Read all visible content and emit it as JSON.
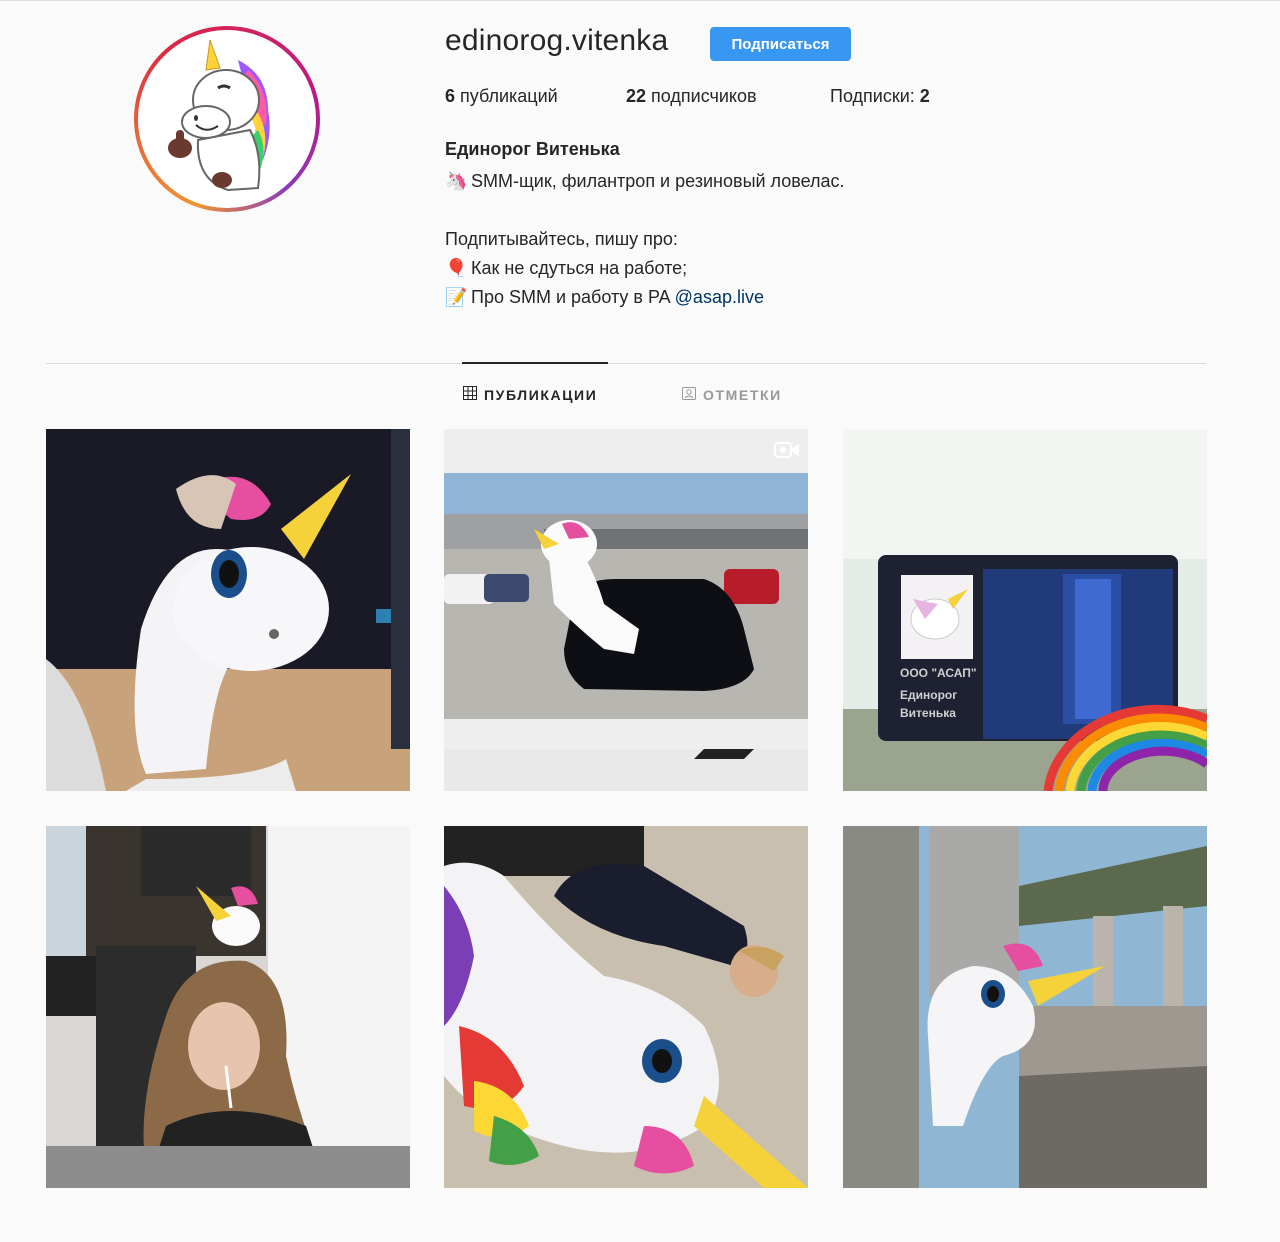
{
  "profile": {
    "username": "edinorog.vitenka",
    "follow_label": "Подписаться",
    "stats": {
      "posts_count": "6",
      "posts_label": " публикаций",
      "followers_count": "22",
      "followers_label": " подписчиков",
      "following_label": "Подписки: ",
      "following_count": "2"
    },
    "full_name": "Единорог Витенька",
    "bio": {
      "line1_emoji": "🦄",
      "line1": "SMM-щик, филантроп и резиновый ловелас.",
      "line2": "Подпитывайтесь, пишу про:",
      "line3_emoji": "🎈",
      "line3": "Как не сдуться на работе;",
      "line4_emoji": "📝",
      "line4": "Про SMM и работу в PA ",
      "line4_link": "@asap.live"
    }
  },
  "tabs": [
    {
      "label": "ПУБЛИКАЦИИ",
      "icon": "grid-icon",
      "active": true
    },
    {
      "label": "ОТМЕТКИ",
      "icon": "tagged-user-icon",
      "active": false
    }
  ],
  "posts": [
    {
      "icon": "post-photo",
      "video": false
    },
    {
      "icon": "post-photo",
      "video": true
    },
    {
      "icon": "post-photo",
      "video": false,
      "card_company": "ООО \"АСАП\"",
      "card_name_1": "Единорог",
      "card_name_2": "Витенька"
    },
    {
      "icon": "post-photo",
      "video": false
    },
    {
      "icon": "post-photo",
      "video": false
    },
    {
      "icon": "post-photo",
      "video": false
    }
  ],
  "colors": {
    "accent": "#3897f0",
    "link": "#003569",
    "text": "#262626",
    "muted": "#999999",
    "background": "#fafafa",
    "divider": "#dbdbdb"
  }
}
